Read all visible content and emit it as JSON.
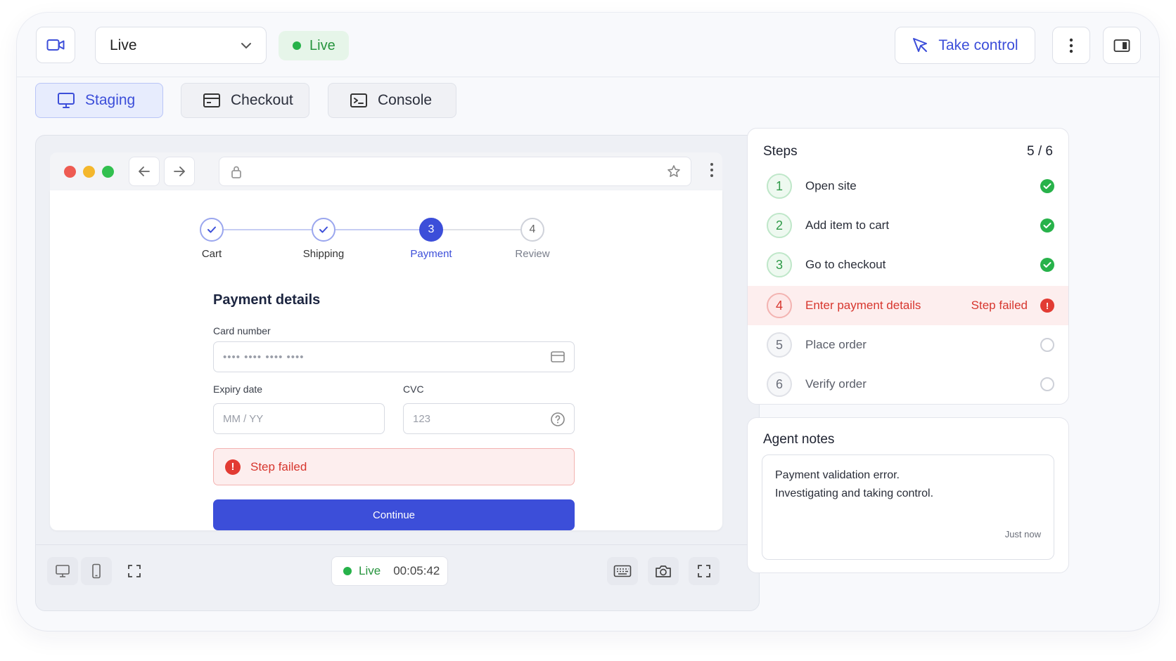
{
  "topbar": {
    "environment": "Live",
    "live_status": "Live",
    "take_control": "Take control"
  },
  "tabs": [
    {
      "label": "Staging",
      "active": true,
      "icon": "monitor-icon"
    },
    {
      "label": "Checkout",
      "active": false,
      "icon": "card-icon"
    },
    {
      "label": "Console",
      "active": false,
      "icon": "terminal-icon"
    }
  ],
  "checkout": {
    "steps": [
      {
        "num": "1",
        "label": "Cart",
        "state": "done"
      },
      {
        "num": "2",
        "label": "Shipping",
        "state": "done"
      },
      {
        "num": "3",
        "label": "Payment",
        "state": "current"
      },
      {
        "num": "4",
        "label": "Review",
        "state": "todo"
      }
    ],
    "title": "Payment details",
    "card_label": "Card number",
    "card_placeholder": "•••• •••• •••• ••••",
    "expiry_label": "Expiry date",
    "expiry_placeholder": "MM / YY",
    "cvc_label": "CVC",
    "cvc_placeholder": "123",
    "error": "Step failed",
    "continue": "Continue"
  },
  "footer": {
    "live": "Live",
    "elapsed": "00:05:42"
  },
  "steps_panel": {
    "title": "Steps",
    "count": "5 / 6",
    "items": [
      {
        "num": "1",
        "label": "Open site",
        "state": "done"
      },
      {
        "num": "2",
        "label": "Add item to cart",
        "state": "done"
      },
      {
        "num": "3",
        "label": "Go to checkout",
        "state": "done"
      },
      {
        "num": "4",
        "label": "Enter payment details",
        "state": "failed",
        "status_text": "Step failed"
      },
      {
        "num": "5",
        "label": "Place order",
        "state": "pending"
      },
      {
        "num": "6",
        "label": "Verify order",
        "state": "pending"
      }
    ]
  },
  "notes": {
    "title": "Agent notes",
    "line1": "Payment validation error.",
    "line2": "Investigating and taking control.",
    "time": "Just now"
  },
  "colors": {
    "accent": "#3c4ed9",
    "success": "#27b24a",
    "error": "#e23b33",
    "background": "#f8f9fc"
  }
}
